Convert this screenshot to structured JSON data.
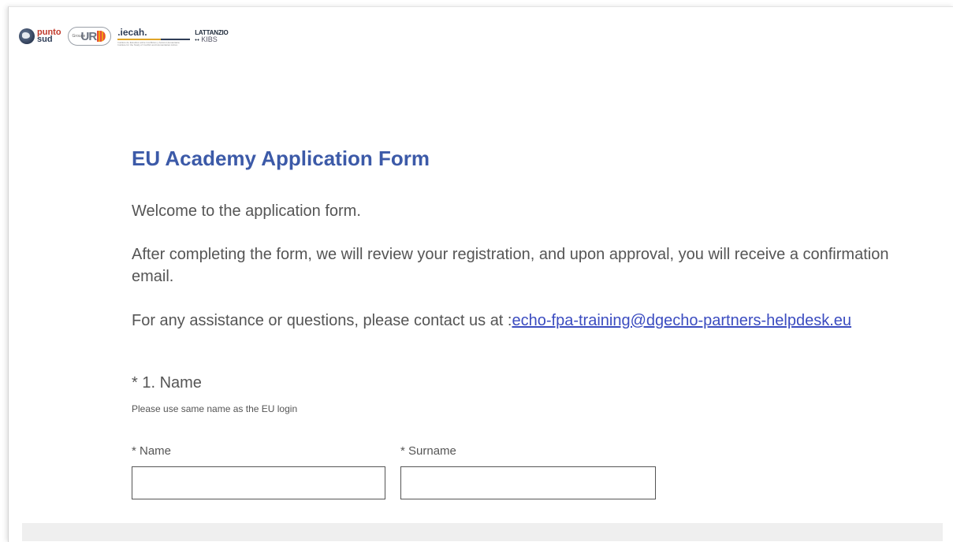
{
  "logos": {
    "punto_sud": {
      "line1": "punto",
      "line2": "sud"
    },
    "urd": {
      "group": "Groupe",
      "letters": "UR"
    },
    "iecah": {
      "name": ".iecah.",
      "tagline1": "Instituto de Estudios sobre Conflictos y Acción Humanitaria",
      "tagline2": "Institute for the Study of Conflict and Humanitarian Action"
    },
    "lattanzio": {
      "line1": "LATTANZIO",
      "line2": "KIBS"
    }
  },
  "form": {
    "title": "EU Academy Application Form",
    "welcome": "Welcome to the application form.",
    "review_text": "After completing the form, we will review your registration, and upon approval, you will receive a confirmation email.",
    "contact_prefix": "For any assistance or questions, please contact us at :",
    "contact_email": "echo-fpa-training@dgecho-partners-helpdesk.eu"
  },
  "question1": {
    "label": "* 1. Name",
    "help": "Please use same name as the EU login",
    "fields": {
      "name_label": "* Name",
      "name_value": "",
      "surname_label": "* Surname",
      "surname_value": ""
    }
  },
  "colors": {
    "title": "#3c5aa8",
    "link": "#3b4cc0",
    "text": "#555555"
  }
}
